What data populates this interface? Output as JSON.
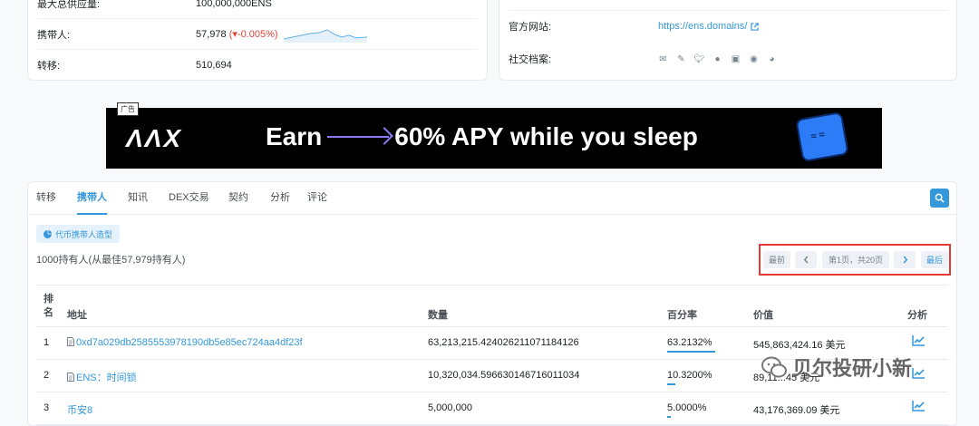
{
  "overview": {
    "rows": [
      {
        "label": "最大总供应量:",
        "value": "100,000,000ENS"
      },
      {
        "label": "携带人:",
        "value": "57,978",
        "change": "(▾-0.005%)"
      },
      {
        "label": "转移:",
        "value": "510,694"
      }
    ]
  },
  "profile": {
    "website_label": "官方网站:",
    "website_url": "https://ens.domains/",
    "social_label": "社交档案:",
    "social_icons": [
      "email-icon",
      "pencil-icon",
      "twitter-icon",
      "github-icon",
      "message-icon",
      "discord-icon",
      "medium-icon"
    ]
  },
  "ad": {
    "tag": "广告",
    "logo": "ΛΛX",
    "earn": "Earn",
    "tagline": "60% APY while you sleep"
  },
  "tabs": [
    "转移",
    "携带人",
    "知讯",
    "DEX交易",
    "契约",
    "分析",
    "评论"
  ],
  "active_tab": 1,
  "holders": {
    "chart_button": "代币携带人造型",
    "count_text": "1000持有人(从最佳57,979持有人)"
  },
  "pager": {
    "first": "最前",
    "page_info": "第1页，共20页",
    "last": "最后"
  },
  "table": {
    "headers": {
      "rank": "排名",
      "address": "地址",
      "quantity": "数量",
      "percent": "百分率",
      "value": "价值",
      "analytics": "分析"
    },
    "rows": [
      {
        "rank": "1",
        "address": "0xd7a029db2585553978190db5e85ec724aa4df23f",
        "quantity": "63,213,215.424026211071184126",
        "percent": "63.2132%",
        "pct": 63.2132,
        "value": "545,863,424.16 美元",
        "has_file_icon": true
      },
      {
        "rank": "2",
        "address": "ENS：时间锁",
        "quantity": "10,320,034.596630146716011034",
        "percent": "10.3200%",
        "pct": 10.32,
        "value": "89,11...45 美元",
        "has_file_icon": true
      },
      {
        "rank": "3",
        "address": "币安8",
        "quantity": "5,000,000",
        "percent": "5.0000%",
        "pct": 5.0,
        "value": "43,176,369.09 美元",
        "has_file_icon": false
      }
    ]
  },
  "watermark": "贝尔投研小新",
  "colors": {
    "accent": "#3498db",
    "negative": "#de4437",
    "highlight": "#e53935"
  }
}
